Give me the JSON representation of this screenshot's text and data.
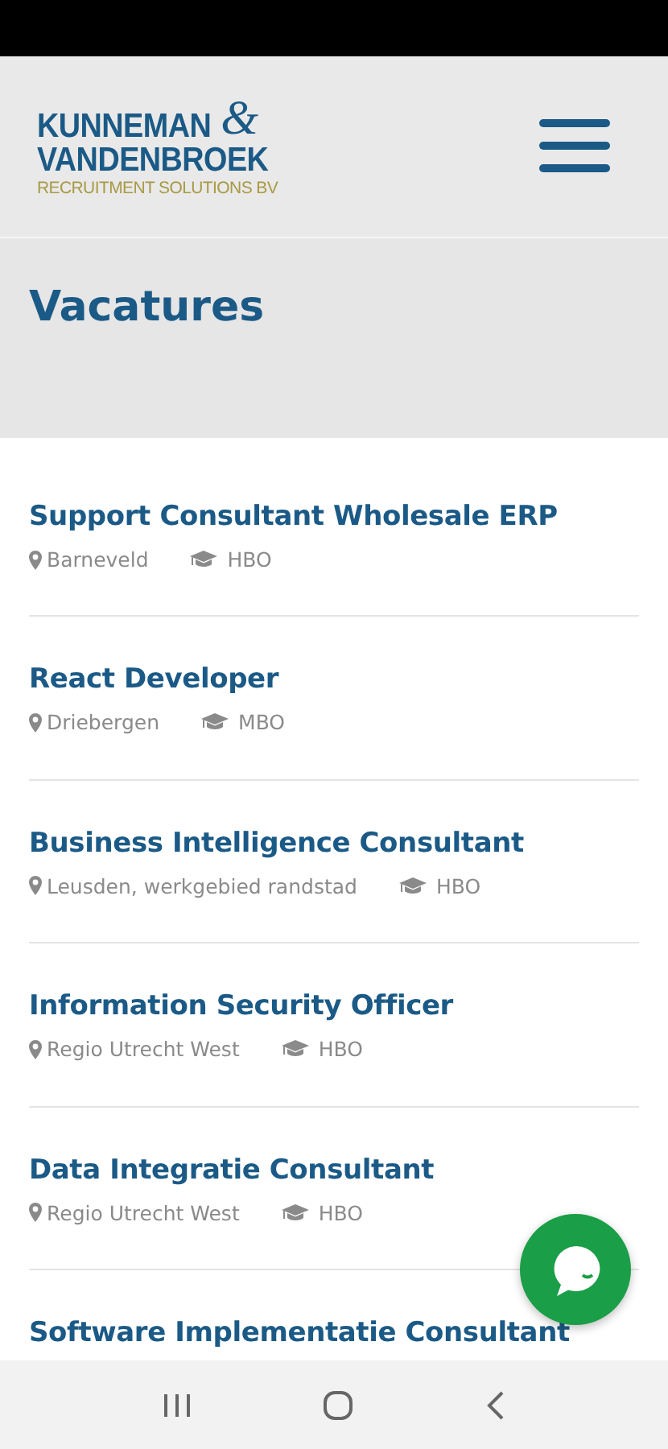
{
  "header": {
    "logo": {
      "line_1": "KUNNEMAN",
      "ampersand": "&",
      "line_2": "VANDENBROEK",
      "tagline": "RECRUITMENT SOLUTIONS BV"
    }
  },
  "page_title": "Vacatures",
  "vacancies": [
    {
      "title": "Support Consultant Wholesale ERP",
      "location": "Barneveld",
      "education": "HBO"
    },
    {
      "title": "React Developer",
      "location": "Driebergen",
      "education": "MBO"
    },
    {
      "title": "Business Intelligence Consultant",
      "location": "Leusden, werkgebied randstad",
      "education": "HBO"
    },
    {
      "title": "Information Security Officer",
      "location": "Regio Utrecht West",
      "education": "HBO"
    },
    {
      "title": "Data Integratie Consultant",
      "location": "Regio Utrecht West",
      "education": "HBO"
    },
    {
      "title": "Software Implementatie Consultant"
    }
  ]
}
